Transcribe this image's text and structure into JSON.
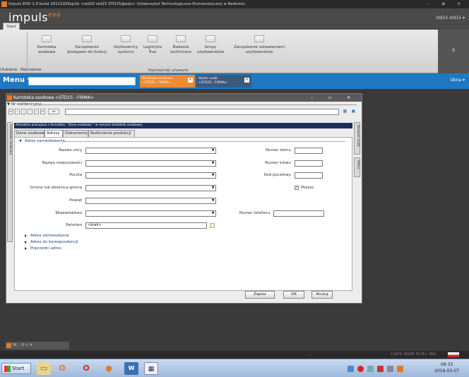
{
  "window": {
    "title": "Impuls EVO 1.0 build 20121026sp1b <std15 std15 STD15@edu> Uniwersytet Technologiczno-Humanistyczny w Radomiu",
    "controls": "– ⧉ ✕"
  },
  "brand": {
    "name": "impuls",
    "sup": "evo",
    "user": "std15 std15 ▾"
  },
  "ribbon": {
    "start_tab": "Start",
    "left_labels": [
      "Ulubione",
      "Najnowsze"
    ],
    "buttons": [
      {
        "line1": "Kartoteka",
        "line2": "osobowa"
      },
      {
        "line1": "Zarządzanie",
        "line2": "dostępem do funkcji"
      },
      {
        "line1": "Użytkownicy",
        "line2": "systemu"
      },
      {
        "line1": "Logistyka",
        "line2": "Tras"
      },
      {
        "line1": "Badania",
        "line2": "techniczne"
      },
      {
        "line1": "Grupy",
        "line2": "użytkowników"
      },
      {
        "line1": "Zarządzanie ustawieniami",
        "line2": "użytkowników"
      }
    ],
    "group_label": "Najczęściej używane",
    "badge": "0"
  },
  "menubar": {
    "menu_label": "Menu ▾",
    "tab_active": {
      "line1": "Kartoteka osobowa",
      "line2": "<STD15 - FIRMA>"
    },
    "tab_other": {
      "line1": "Wybór osób",
      "line2": "<STD15 - FIRMA>"
    },
    "close_glyph": "✕",
    "windows_label": "Okna ▾"
  },
  "dialog": {
    "title": "Kartoteka osobowa <STD15 - FIRMA>",
    "controls": "– ▫ ✕",
    "nr_label": "▼ Nr ewidencyjny:",
    "nav_buttons": [
      "⏮",
      "«",
      "‹",
      "›",
      "»",
      "⏭",
      "≣▾"
    ],
    "side_left": "Kartoteka osobowa",
    "side_right_1": "Browser osób",
    "side_right_2": "Menu",
    "info_text": "Aktualnie pracujesz z formatką \" Dane osobowe \" w ramach kartoteki osobowej",
    "tabs": [
      "Dane osobowe",
      "Adresy",
      "Dokumenty",
      "Rozliczenie produkcji"
    ],
    "section_main": "Adres zameldowania",
    "fields_left": [
      "Nazwa ulicy",
      "Nazwa miejscowości",
      "Poczta",
      "Gmina lub dzielnica-gmina",
      "Powiat",
      "Województwo",
      "Państwo"
    ],
    "fields_right": [
      "Numer domu",
      "Numer lokalu",
      "Kod pocztowy"
    ],
    "miasto_label": "Miasto",
    "miasto_checked": "✓",
    "phone_label": "Numer telefonu",
    "country_value": "<brak>",
    "sections_collapsed": [
      "Adres zamieszkania",
      "Adres do korespondencji",
      "Poprzedni adres"
    ],
    "buttons": {
      "save": "Zapisz",
      "ok": "OK",
      "cancel": "Anuluj"
    }
  },
  "mini_window": {
    "label": "W...   ⟲  ▫  ✕"
  },
  "statusbar": {
    "dots": "...",
    "indicators": "CAPS  NUM  SCRL  INS"
  },
  "taskbar": {
    "start": "Start",
    "time": "08:33",
    "date": "2016-03-07"
  }
}
